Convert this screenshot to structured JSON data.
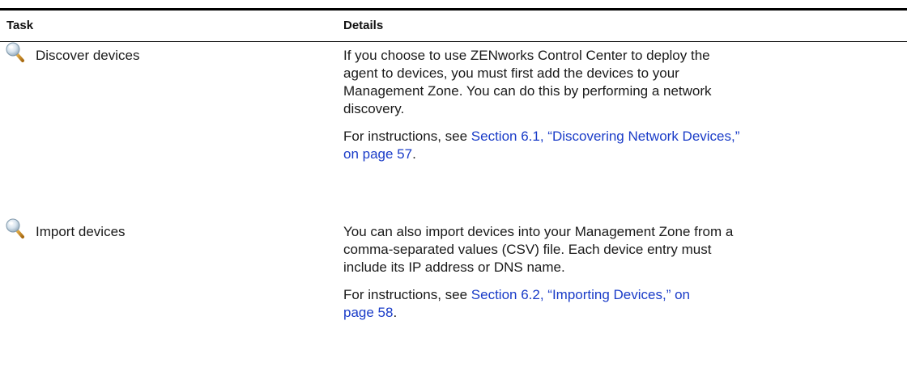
{
  "table": {
    "headers": {
      "task": "Task",
      "details": "Details"
    },
    "rows": [
      {
        "icon": "magnifier-icon",
        "task": "Discover devices",
        "description_lines": [
          "If you choose to use ZENworks Control Center to deploy the",
          "agent to devices, you must first add the devices to your",
          "Management Zone. You can do this by performing a network",
          "discovery."
        ],
        "instructions_prefix": "For instructions, see ",
        "link_line1": "Section 6.1, “Discovering Network Devices,”",
        "link_line2": "on page 57",
        "instructions_suffix": "."
      },
      {
        "icon": "magnifier-icon",
        "task": "Import devices",
        "description_lines": [
          "You can also import devices into your Management Zone from a",
          "comma-separated values (CSV) file. Each device entry must",
          "include its IP address or DNS name."
        ],
        "instructions_prefix": "For instructions, see ",
        "link_line1": "Section 6.2, “Importing Devices,” on",
        "link_line2": "page 58",
        "instructions_suffix": "."
      }
    ]
  }
}
